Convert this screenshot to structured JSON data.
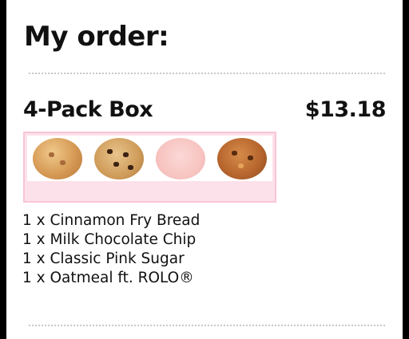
{
  "order": {
    "title": "My order:",
    "item": {
      "name": "4-Pack Box",
      "price": "$13.18",
      "cookies": [
        "cinnamon-fry-bread-cookie-icon",
        "milk-chocolate-chip-cookie-icon",
        "classic-pink-sugar-cookie-icon",
        "oatmeal-rolo-cookie-icon"
      ],
      "lines": [
        "1 x Cinnamon Fry Bread",
        "1 x Milk Chocolate Chip",
        "1 x Classic Pink Sugar",
        "1 x Oatmeal ft. ROLO®"
      ]
    }
  },
  "colors": {
    "box_pink": "#fde1ea",
    "box_border": "#f8c5d5"
  }
}
